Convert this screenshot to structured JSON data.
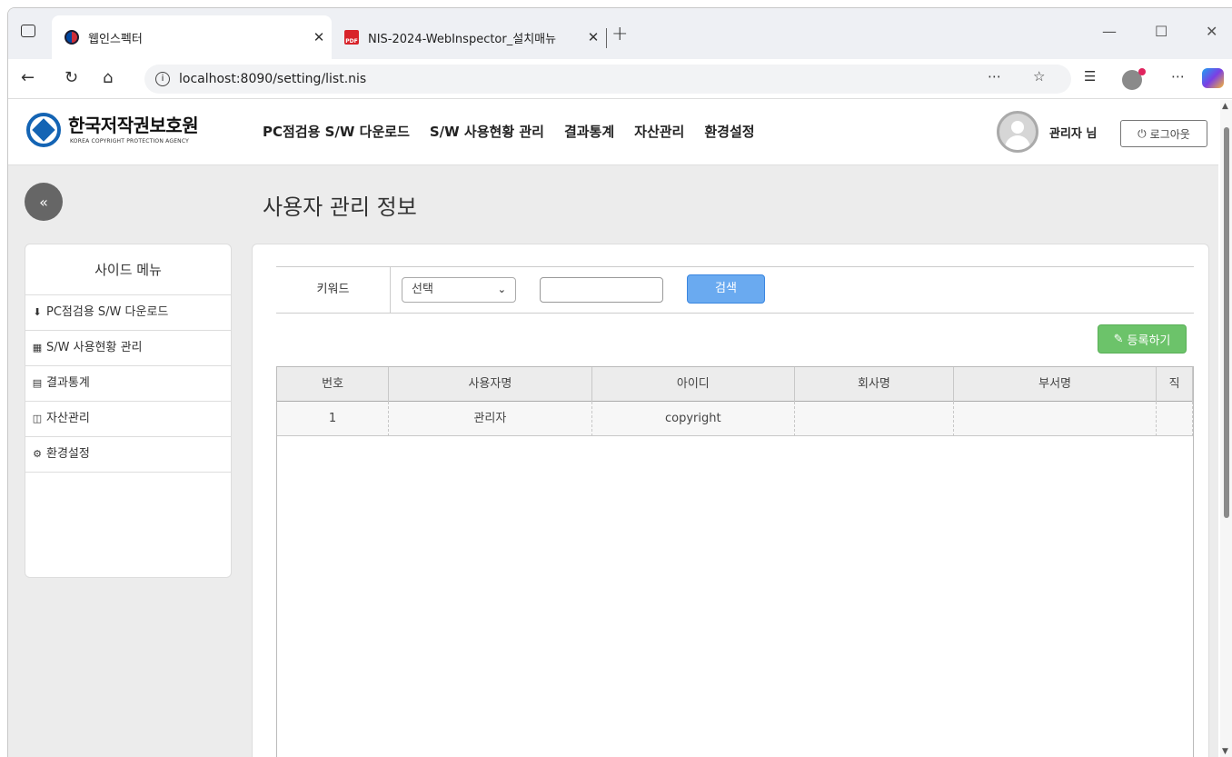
{
  "browser": {
    "tabs": [
      {
        "title": "웹인스펙터",
        "active": true
      },
      {
        "title": "NIS-2024-WebInspector_설치매뉴",
        "active": false
      }
    ],
    "url": "localhost:8090/setting/list.nis",
    "pdf_badge": "PDF"
  },
  "header": {
    "logo_text": "한국저작권보호원",
    "logo_sub": "KOREA COPYRIGHT PROTECTION AGENCY",
    "nav": [
      "PC점검용 S/W 다운로드",
      "S/W 사용현황 관리",
      "결과통계",
      "자산관리",
      "환경설정"
    ],
    "user_label": "관리자 님",
    "logout_label": "로그아웃"
  },
  "page": {
    "collapse_label": "«",
    "title": "사용자 관리 정보"
  },
  "sidebar": {
    "title": "사이드 메뉴",
    "items": [
      {
        "label": "PC점검용 S/W 다운로드",
        "icon": "download-icon"
      },
      {
        "label": "S/W 사용현황 관리",
        "icon": "table-icon"
      },
      {
        "label": "결과통계",
        "icon": "document-icon"
      },
      {
        "label": "자산관리",
        "icon": "columns-icon"
      },
      {
        "label": "환경설정",
        "icon": "gear-icon"
      }
    ]
  },
  "search": {
    "label": "키워드",
    "select_value": "선택",
    "input_value": "",
    "button_label": "검색"
  },
  "register_label": "등록하기",
  "table": {
    "headers": [
      "번호",
      "사용자명",
      "아이디",
      "회사명",
      "부서명",
      "직"
    ],
    "rows": [
      [
        "1",
        "관리자",
        "copyright",
        "",
        "",
        ""
      ]
    ]
  }
}
